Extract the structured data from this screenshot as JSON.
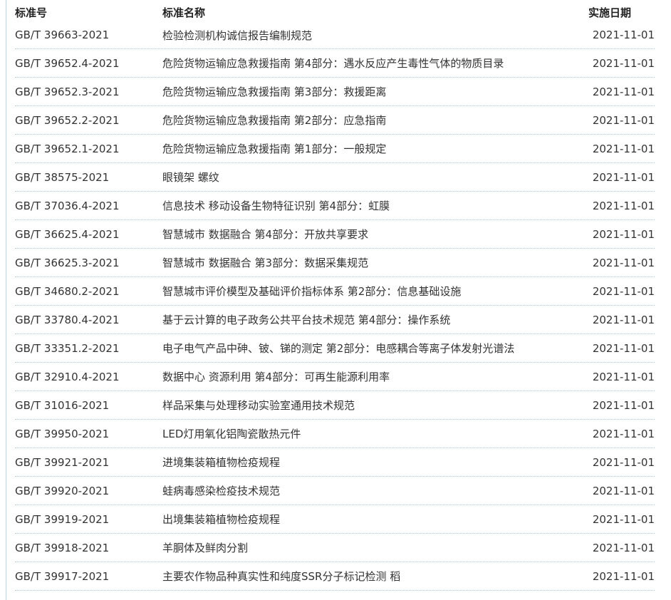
{
  "headers": {
    "no": "标准号",
    "name": "标准名称",
    "date": "实施日期"
  },
  "rows": [
    {
      "no": "GB/T 39663-2021",
      "name": "检验检测机构诚信报告编制规范",
      "date": "2021-11-01"
    },
    {
      "no": "GB/T 39652.4-2021",
      "name": "危险货物运输应急救援指南 第4部分：遇水反应产生毒性气体的物质目录",
      "date": "2021-11-01"
    },
    {
      "no": "GB/T 39652.3-2021",
      "name": "危险货物运输应急救援指南 第3部分：救援距离",
      "date": "2021-11-01"
    },
    {
      "no": "GB/T 39652.2-2021",
      "name": "危险货物运输应急救援指南 第2部分：应急指南",
      "date": "2021-11-01"
    },
    {
      "no": "GB/T 39652.1-2021",
      "name": "危险货物运输应急救援指南 第1部分：一般规定",
      "date": "2021-11-01"
    },
    {
      "no": "GB/T 38575-2021",
      "name": "眼镜架 螺纹",
      "date": "2021-11-01"
    },
    {
      "no": "GB/T 37036.4-2021",
      "name": "信息技术 移动设备生物特征识别 第4部分：虹膜",
      "date": "2021-11-01"
    },
    {
      "no": "GB/T 36625.4-2021",
      "name": "智慧城市 数据融合 第4部分：开放共享要求",
      "date": "2021-11-01"
    },
    {
      "no": "GB/T 36625.3-2021",
      "name": "智慧城市 数据融合 第3部分：数据采集规范",
      "date": "2021-11-01"
    },
    {
      "no": "GB/T 34680.2-2021",
      "name": "智慧城市评价模型及基础评价指标体系 第2部分：信息基础设施",
      "date": "2021-11-01"
    },
    {
      "no": "GB/T 33780.4-2021",
      "name": "基于云计算的电子政务公共平台技术规范 第4部分：操作系统",
      "date": "2021-11-01"
    },
    {
      "no": "GB/T 33351.2-2021",
      "name": "电子电气产品中砷、铍、锑的测定 第2部分：电感耦合等离子体发射光谱法",
      "date": "2021-11-01"
    },
    {
      "no": "GB/T 32910.4-2021",
      "name": "数据中心 资源利用 第4部分：可再生能源利用率",
      "date": "2021-11-01"
    },
    {
      "no": "GB/T 31016-2021",
      "name": "样品采集与处理移动实验室通用技术规范",
      "date": "2021-11-01"
    },
    {
      "no": "GB/T 39950-2021",
      "name": "LED灯用氧化铝陶瓷散热元件",
      "date": "2021-11-01"
    },
    {
      "no": "GB/T 39921-2021",
      "name": "进境集装箱植物检疫规程",
      "date": "2021-11-01"
    },
    {
      "no": "GB/T 39920-2021",
      "name": "蛙病毒感染检疫技术规范",
      "date": "2021-11-01"
    },
    {
      "no": "GB/T 39919-2021",
      "name": "出境集装箱植物检疫规程",
      "date": "2021-11-01"
    },
    {
      "no": "GB/T 39918-2021",
      "name": "羊胴体及鲜肉分割",
      "date": "2021-11-01"
    },
    {
      "no": "GB/T 39917-2021",
      "name": "主要农作物品种真实性和纯度SSR分子标记检测 稻",
      "date": "2021-11-01"
    }
  ]
}
